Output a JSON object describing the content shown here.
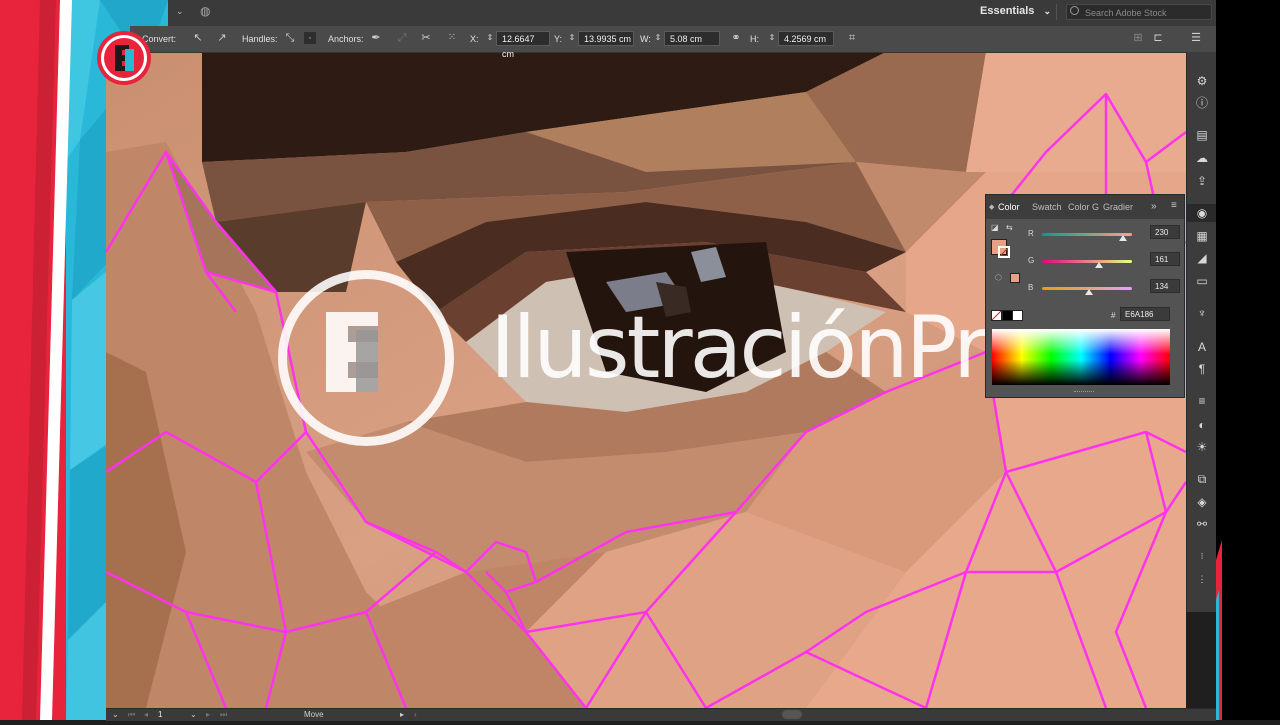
{
  "topbar": {
    "workspace_label": "Essentials",
    "search_placeholder": "Search Adobe Stock"
  },
  "controlbar": {
    "convert_label": "Convert:",
    "handles_label": "Handles:",
    "anchors_label": "Anchors:",
    "x_label": "X:",
    "x_value": "12.6647 cm",
    "y_label": "Y:",
    "y_value": "13.9935 cm",
    "w_label": "W:",
    "w_value": "5.08 cm",
    "h_label": "H:",
    "h_value": "4.2569 cm"
  },
  "color_panel": {
    "tabs": [
      "Color",
      "Swatch",
      "Color G",
      "Gradier"
    ],
    "active_tab": "Color",
    "channels": [
      {
        "label": "R",
        "value": "230",
        "fraction": 0.902
      },
      {
        "label": "G",
        "value": "161",
        "fraction": 0.631
      },
      {
        "label": "B",
        "value": "134",
        "fraction": 0.525
      }
    ],
    "hex_prefix": "#",
    "hex_value": "E6A186",
    "fill_color": "#E6A186"
  },
  "statusbar": {
    "artboard_number": "1",
    "tool_status": "Move"
  },
  "watermark": {
    "brand": "IlustraciónPro",
    "logo_letter": "E"
  },
  "colors": {
    "selection_path": "#ff33ee",
    "skin": "#e8a88c",
    "band_cyan": "#2ab8d8",
    "band_red": "#e8243c"
  },
  "dock_icons": [
    "gear-icon",
    "info-icon",
    "document-icon",
    "libraries-icon",
    "export-icon",
    "color-icon",
    "swatches-icon",
    "brushes-icon",
    "gradient-icon",
    "puppet-icon",
    "character-icon",
    "paragraph-icon",
    "align-icon",
    "pathfinder-icon",
    "appearance-icon",
    "artboards-icon",
    "layers-icon",
    "links-icon"
  ]
}
